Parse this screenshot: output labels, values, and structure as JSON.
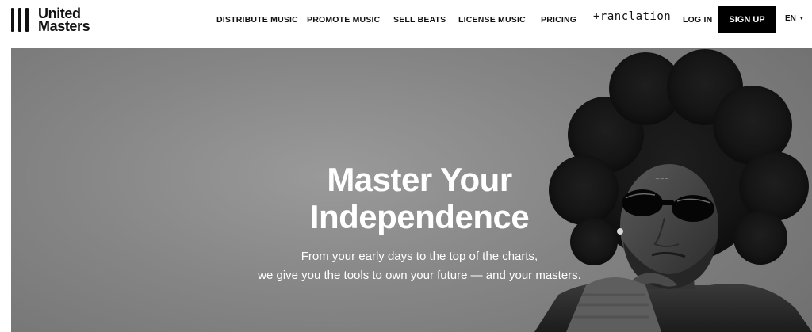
{
  "brand": {
    "line1": "United",
    "line2": "Masters"
  },
  "nav": {
    "items": [
      {
        "label": "DISTRIBUTE MUSIC"
      },
      {
        "label": "PROMOTE MUSIC"
      },
      {
        "label": "SELL BEATS"
      },
      {
        "label": "LICENSE MUSIC"
      },
      {
        "label": "PRICING"
      }
    ],
    "translation_label": "+ranclation",
    "login_label": "LOG IN",
    "signup_label": "SIGN UP",
    "language": "EN"
  },
  "hero": {
    "title_line1": "Master Your",
    "title_line2": "Independence",
    "subtitle_line1": "From your early days to the top of the charts,",
    "subtitle_line2": "we give you the tools to own your future — and your masters."
  }
}
